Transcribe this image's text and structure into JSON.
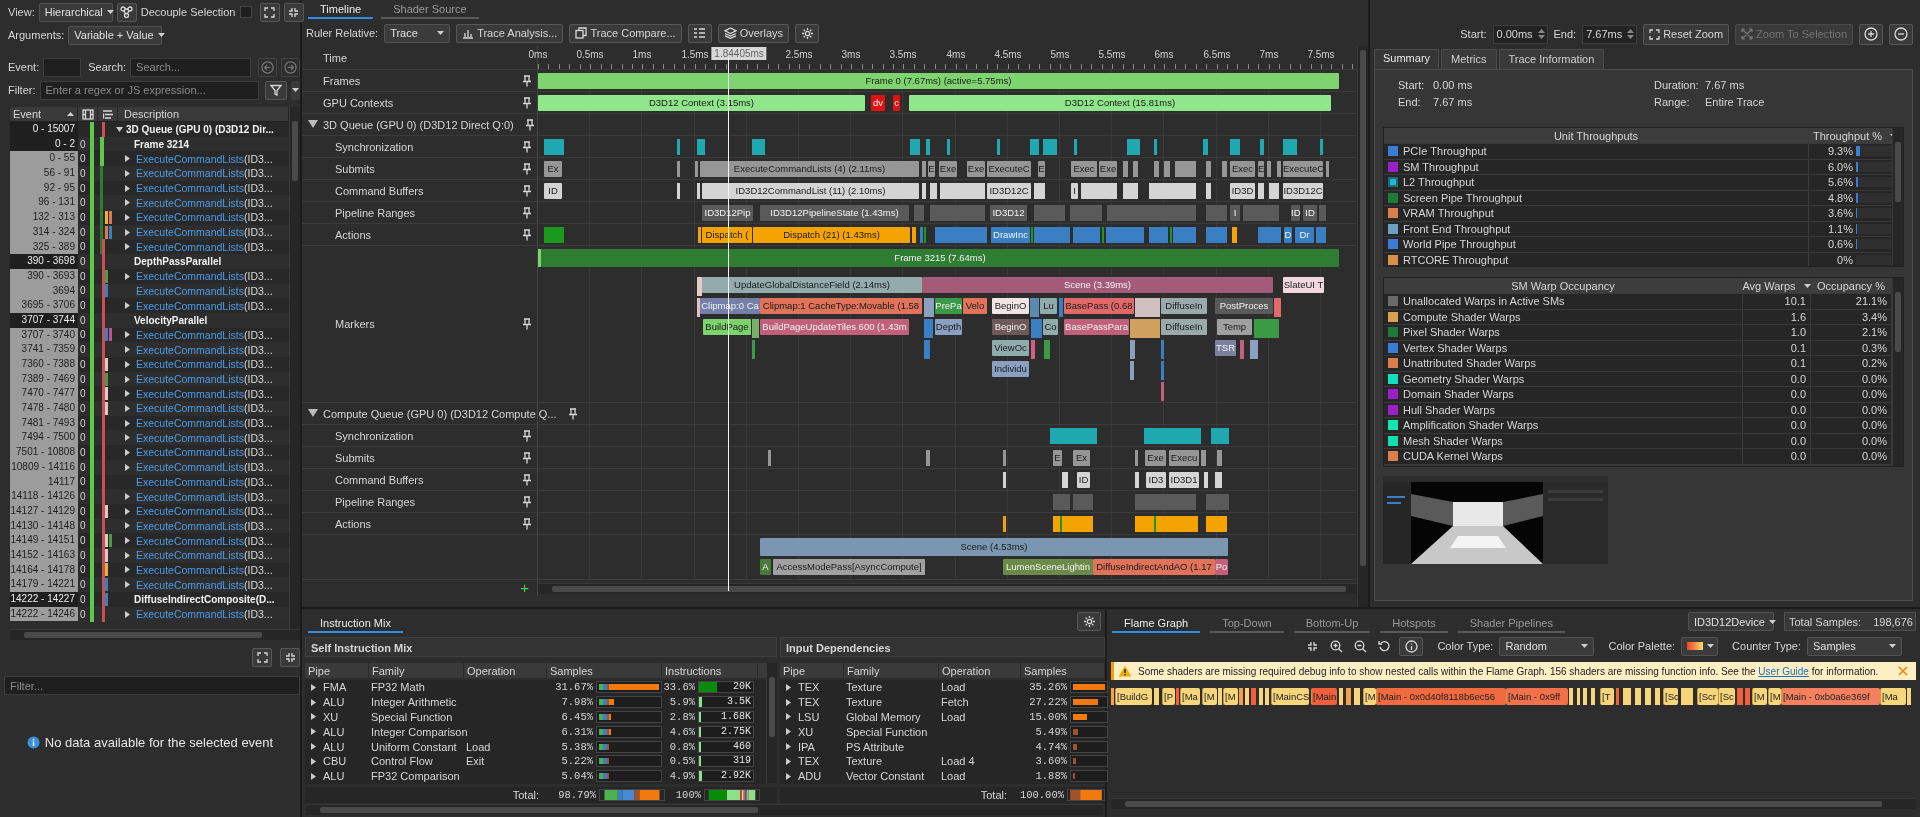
{
  "left_panel": {
    "view_label": "View:",
    "view": "Hierarchical",
    "decouple_label": "Decouple Selection",
    "decouple_checked": false,
    "arguments_label": "Arguments:",
    "arguments": "Variable + Value",
    "event_label": "Event:",
    "search_label": "Search:",
    "search_placeholder": "Search...",
    "filter_label": "Filter:",
    "filter_placeholder": "Enter a regex or JS expression...",
    "columns": [
      "Event",
      "Description"
    ],
    "rows": [
      {
        "event": "0 - 15007",
        "description": "3D Queue (GPU 0) (D3D12 Dir...",
        "kind": "queue",
        "expanded": true,
        "children": [
          {
            "event": "0 - 2",
            "count": "0",
            "description": "Frame 3214",
            "kind": "marker"
          },
          {
            "event": "0 - 55",
            "count": "0",
            "call": "ExecuteCommandLists",
            "args": "(ID3...",
            "kind": "call",
            "expanded": false
          },
          {
            "event": "56 - 91",
            "count": "0",
            "call": "ExecuteCommandLists",
            "args": "(ID3...",
            "kind": "call",
            "expanded": false
          },
          {
            "event": "92 - 95",
            "count": "0",
            "call": "ExecuteCommandLists",
            "args": "(ID3...",
            "kind": "call",
            "expanded": false
          },
          {
            "event": "96 - 131",
            "count": "0",
            "call": "ExecuteCommandLists",
            "args": "(ID3...",
            "kind": "call",
            "expanded": false
          },
          {
            "event": "132 - 313",
            "count": "0",
            "call": "ExecuteCommandLists",
            "args": "(ID3...",
            "kind": "call",
            "expanded": false
          },
          {
            "event": "314 - 324",
            "count": "0",
            "call": "ExecuteCommandLists",
            "args": "(ID3...",
            "kind": "call",
            "expanded": false
          },
          {
            "event": "325 - 389",
            "count": "0",
            "call": "ExecuteCommandLists",
            "args": "(ID3...",
            "kind": "call",
            "expanded": false
          },
          {
            "event": "390 - 3698",
            "count": "0",
            "description": "DepthPassParallel",
            "kind": "marker"
          },
          {
            "event": "390 - 3693",
            "count": "0",
            "call": "ExecuteCommandLists",
            "args": "(ID3...",
            "kind": "call",
            "expanded": false
          },
          {
            "event": "3694",
            "count": "0",
            "call": "ExecuteCommandLists",
            "args": "(ID3...",
            "kind": "call"
          },
          {
            "event": "3695 - 3706",
            "count": "0",
            "call": "ExecuteCommandLists",
            "args": "(ID3...",
            "kind": "call",
            "expanded": false
          },
          {
            "event": "3707 - 3744",
            "count": "0",
            "description": "VelocityParallel",
            "kind": "marker"
          },
          {
            "event": "3707 - 3740",
            "count": "0",
            "call": "ExecuteCommandLists",
            "args": "(ID3...",
            "kind": "call",
            "expanded": false
          },
          {
            "event": "3741 - 7359",
            "count": "0",
            "call": "ExecuteCommandLists",
            "args": "(ID3...",
            "kind": "call",
            "expanded": false
          },
          {
            "event": "7360 - 7388",
            "count": "0",
            "call": "ExecuteCommandLists",
            "args": "(ID3...",
            "kind": "call",
            "expanded": false
          },
          {
            "event": "7389 - 7469",
            "count": "0",
            "call": "ExecuteCommandLists",
            "args": "(ID3...",
            "kind": "call",
            "expanded": false
          },
          {
            "event": "7470 - 7477",
            "count": "0",
            "call": "ExecuteCommandLists",
            "args": "(ID3...",
            "kind": "call",
            "expanded": false
          },
          {
            "event": "7478 - 7480",
            "count": "0",
            "call": "ExecuteCommandLists",
            "args": "(ID3...",
            "kind": "call",
            "expanded": false
          },
          {
            "event": "7481 - 7493",
            "count": "0",
            "call": "ExecuteCommandLists",
            "args": "(ID3...",
            "kind": "call",
            "expanded": false
          },
          {
            "event": "7494 - 7500",
            "count": "0",
            "call": "ExecuteCommandLists",
            "args": "(ID3...",
            "kind": "call",
            "expanded": false
          },
          {
            "event": "7501 - 10808",
            "count": "0",
            "call": "ExecuteCommandLists",
            "args": "(ID3...",
            "kind": "call",
            "expanded": false
          },
          {
            "event": "10809 - 14116",
            "count": "0",
            "call": "ExecuteCommandLists",
            "args": "(ID3...",
            "kind": "call",
            "expanded": false
          },
          {
            "event": "14117",
            "count": "0",
            "call": "ExecuteCommandLists",
            "args": "(ID3...",
            "kind": "call"
          },
          {
            "event": "14118 - 14126",
            "count": "0",
            "call": "ExecuteCommandLists",
            "args": "(ID3...",
            "kind": "call",
            "expanded": false
          },
          {
            "event": "14127 - 14129",
            "count": "0",
            "call": "ExecuteCommandLists",
            "args": "(ID3...",
            "kind": "call",
            "expanded": false
          },
          {
            "event": "14130 - 14148",
            "count": "0",
            "call": "ExecuteCommandLists",
            "args": "(ID3...",
            "kind": "call",
            "expanded": false
          },
          {
            "event": "14149 - 14151",
            "count": "0",
            "call": "ExecuteCommandLists",
            "args": "(ID3...",
            "kind": "call",
            "expanded": false
          },
          {
            "event": "14152 - 14163",
            "count": "0",
            "call": "ExecuteCommandLists",
            "args": "(ID3...",
            "kind": "call",
            "expanded": false
          },
          {
            "event": "14164 - 14178",
            "count": "0",
            "call": "ExecuteCommandLists",
            "args": "(ID3...",
            "kind": "call",
            "expanded": false
          },
          {
            "event": "14179 - 14221",
            "count": "0",
            "call": "ExecuteCommandLists",
            "args": "(ID3...",
            "kind": "call",
            "expanded": false
          },
          {
            "event": "14222 - 14227",
            "count": "0",
            "description": "DiffuseIndirectComposite(D...",
            "kind": "marker"
          },
          {
            "event": "14222 - 14246",
            "count": "0",
            "call": "ExecuteCommandLists",
            "args": "(ID3...",
            "kind": "call",
            "expanded": false
          }
        ]
      }
    ],
    "details_filter_placeholder": "Filter...",
    "message": "No data available for the selected event"
  },
  "view_tabs": [
    {
      "label": "Timeline",
      "selected": true
    },
    {
      "label": "Shader Source",
      "selected": false
    }
  ],
  "timeline_toolbar": {
    "ruler_label": "Ruler Relative:",
    "ruler": "Trace",
    "buttons": [
      "Trace Analysis...",
      "Trace Compare...",
      "Overlays"
    ]
  },
  "timeline": {
    "time_label": "Time",
    "ticks": [
      "0ms",
      "0.5ms",
      "1ms",
      "1.5ms",
      "2.5ms",
      "3ms",
      "3.5ms",
      "4ms",
      "4.5ms",
      "5ms",
      "5.5ms",
      "6ms",
      "6.5ms",
      "7ms",
      "7.5ms"
    ],
    "cursor": "1.84405ms",
    "add_track": "+",
    "tracks": [
      {
        "label": "Frames",
        "kind": "track",
        "bars": [
          {
            "label": "Frame 0 (7.67ms) (active=5.75ms)",
            "color": "#7ed56f"
          }
        ]
      },
      {
        "label": "GPU Contexts",
        "kind": "track",
        "bars": [
          {
            "label": "D3D12 Context (3.15ms)",
            "color": "#90e68a"
          },
          {
            "label": "dv",
            "color": "#e01010"
          },
          {
            "label": "c",
            "color": "#e01010"
          },
          {
            "label": "D3D12 Context (15.81ms)",
            "color": "#90e68a"
          }
        ]
      },
      {
        "label": "3D Queue (GPU 0) (D3D12 Direct Q:0)",
        "kind": "queue",
        "expanded": true
      },
      {
        "label": "Synchronization",
        "kind": "sub"
      },
      {
        "label": "Submits",
        "kind": "sub",
        "bars": [
          {
            "label": "Ex",
            "color": "#969696"
          },
          {
            "label": "ExecuteCommandLists (4) (2.11ms)",
            "color": "#969696"
          },
          {
            "label": "E",
            "color": "#969696"
          },
          {
            "label": "Exe",
            "color": "#969696"
          },
          {
            "label": "Exe",
            "color": "#969696"
          },
          {
            "label": "ExecuteC",
            "color": "#969696"
          },
          {
            "label": "E",
            "color": "#969696"
          },
          {
            "label": "Exec",
            "color": "#969696"
          },
          {
            "label": "Exe",
            "color": "#969696"
          },
          {
            "label": "Exec",
            "color": "#969696"
          },
          {
            "label": "E",
            "color": "#969696"
          },
          {
            "label": "ExecuteC",
            "color": "#969696"
          }
        ]
      },
      {
        "label": "Command Buffers",
        "kind": "sub",
        "bars": [
          {
            "label": "ID",
            "color": "#d4d4d4"
          },
          {
            "label": "ID3D12CommandList (11) (2.10ms)",
            "color": "#d4d4d4"
          },
          {
            "label": "ID3D12C",
            "color": "#d4d4d4"
          },
          {
            "label": "I",
            "color": "#d4d4d4"
          },
          {
            "label": "ID3D",
            "color": "#d4d4d4"
          },
          {
            "label": "ID3D12C",
            "color": "#d4d4d4"
          }
        ]
      },
      {
        "label": "Pipeline Ranges",
        "kind": "sub",
        "bars": [
          {
            "label": "ID3D12Pip",
            "color": "#5a5a5a"
          },
          {
            "label": "ID3D12PipelineState (1.43ms)",
            "color": "#5a5a5a"
          },
          {
            "label": "ID3D12",
            "color": "#5a5a5a"
          },
          {
            "label": "I",
            "color": "#5a5a5a"
          },
          {
            "label": "ID",
            "color": "#5a5a5a"
          },
          {
            "label": "ID",
            "color": "#5a5a5a"
          }
        ]
      },
      {
        "label": "Actions",
        "kind": "sub",
        "bars": [
          {
            "label": "Dispatch (",
            "color": "#f5a300"
          },
          {
            "label": "Dispatch (21) (1.43ms)",
            "color": "#f5a300"
          },
          {
            "label": "DrawInc",
            "color": "#3a7fc4"
          },
          {
            "label": "D",
            "color": "#3a7fc4"
          },
          {
            "label": "Dr",
            "color": "#3a7fc4"
          }
        ]
      },
      {
        "label": "Markers",
        "kind": "markers",
        "levels": [
          {
            "bars": [
              {
                "label": "Frame 3215 (7.64ms)",
                "color": "#2e7d32"
              }
            ]
          },
          {
            "bars": [
              {
                "label": "UpdateGlobalDistanceField (2.14ms)",
                "color": "#93abab"
              },
              {
                "label": "Scene (3.39ms)",
                "color": "#a55a78"
              },
              {
                "label": "SlateUI T",
                "color": "#f2d8de"
              }
            ]
          },
          {
            "bars": [
              {
                "label": "Clipmap:0 Ca",
                "color": "#7480a8"
              },
              {
                "label": "Clipmap:1 CacheType:Movable (1.58",
                "color": "#e0735a"
              },
              {
                "label": "PrePa",
                "color": "#3a9a45"
              },
              {
                "label": "Velo",
                "color": "#e0735a"
              },
              {
                "label": "BeginO",
                "color": "#f0e4e4"
              },
              {
                "label": "Lu",
                "color": "#8fabab"
              },
              {
                "label": "BasePass (0.68",
                "color": "#e06a6a"
              },
              {
                "label": "DiffuseIn",
                "color": "#9aaaaa"
              },
              {
                "label": "PostProces",
                "color": "#5a5a5a"
              }
            ]
          },
          {
            "bars": [
              {
                "label": "BuildPage",
                "color": "#7cd36b"
              },
              {
                "label": "BuildPageUpdateTiles 600 (1.43m",
                "color": "#c0607a"
              },
              {
                "label": "Depth",
                "color": "#8aa0c0"
              },
              {
                "label": "BeginO",
                "color": "#6e5858"
              },
              {
                "label": "Co",
                "color": "#8fabab"
              },
              {
                "label": "BasePassPara",
                "color": "#c0607a"
              },
              {
                "label": "DiffuseIn",
                "color": "#9aaaaa"
              },
              {
                "label": "Temp",
                "color": "#a0a0a0"
              }
            ]
          },
          {
            "bars": [
              {
                "label": "ViewOc",
                "color": "#8fabab"
              },
              {
                "label": "TSR",
                "color": "#7a82a0"
              }
            ]
          },
          {
            "bars": [
              {
                "label": "Individu",
                "color": "#8aa0c0"
              }
            ]
          }
        ]
      },
      {
        "label": "Compute Queue (GPU 0) (D3D12 Compute Q...",
        "kind": "queue",
        "expanded": true
      },
      {
        "label": "Synchronization",
        "kind": "sub"
      },
      {
        "label": "Submits",
        "kind": "sub",
        "bars": [
          {
            "label": "E",
            "color": "#969696"
          },
          {
            "label": "Ex",
            "color": "#969696"
          },
          {
            "label": "Exe",
            "color": "#969696"
          },
          {
            "label": "Execu",
            "color": "#969696"
          }
        ]
      },
      {
        "label": "Command Buffers",
        "kind": "sub",
        "bars": [
          {
            "label": "ID",
            "color": "#d4d4d4"
          },
          {
            "label": "ID3",
            "color": "#d4d4d4"
          },
          {
            "label": "ID3D1",
            "color": "#d4d4d4"
          }
        ]
      },
      {
        "label": "Pipeline Ranges",
        "kind": "sub"
      },
      {
        "label": "Actions",
        "kind": "sub"
      },
      {
        "kind": "markers",
        "levels": [
          {
            "bars": [
              {
                "label": "Scene (4.53ms)",
                "color": "#7b96b0"
              }
            ]
          },
          {
            "bars": [
              {
                "label": "A",
                "color": "#4a7a3a"
              },
              {
                "label": "AccessModePass[AsyncCompute]",
                "color": "#a0a0a0"
              },
              {
                "label": "LumenSceneLightin",
                "color": "#6b8a4a"
              },
              {
                "label": "DiffuseIndirectAndAO (1.17",
                "color": "#e0735a"
              },
              {
                "label": "Po",
                "color": "#c0607a"
              }
            ]
          }
        ]
      }
    ]
  },
  "range": {
    "start_label": "Start:",
    "start": "0.00ms",
    "end_label": "End:",
    "end": "7.67ms",
    "buttons": [
      {
        "label": "Reset Zoom",
        "disabled": false
      },
      {
        "label": "Zoom To Selection",
        "disabled": true
      }
    ]
  },
  "summary_tabs": [
    {
      "label": "Summary",
      "selected": true
    },
    {
      "label": "Metrics",
      "selected": false
    },
    {
      "label": "Trace Information",
      "selected": false
    }
  ],
  "summary": {
    "fields": [
      {
        "label": "Start:",
        "value": "0.00 ms"
      },
      {
        "label": "Duration:",
        "value": "7.67 ms"
      },
      {
        "label": "End:",
        "value": "7.67 ms"
      },
      {
        "label": "Range:",
        "value": "Entire Trace"
      }
    ]
  },
  "throughputs": {
    "columns": [
      "Unit Throughputs",
      "Throughput %"
    ],
    "rows": [
      {
        "name": "PCIe Throughput",
        "color": "#3a7bd5",
        "value": "9.3%",
        "level": 0.093
      },
      {
        "name": "SM Throughput",
        "color": "#9b1fc9",
        "value": "6.0%",
        "level": 0.06
      },
      {
        "name": "L2 Throughput",
        "color": "#2ab0c8",
        "value": "5.6%",
        "level": 0.056
      },
      {
        "name": "Screen Pipe Throughput",
        "color": "#1f7a3a",
        "value": "4.8%",
        "level": 0.048
      },
      {
        "name": "VRAM Throughput",
        "color": "#d9804a",
        "value": "3.6%",
        "level": 0.036
      },
      {
        "name": "Front End Throughput",
        "color": "#6f9fc0",
        "value": "1.1%",
        "level": 0.011
      },
      {
        "name": "World Pipe Throughput",
        "color": "#3a7bd6",
        "value": "0.6%",
        "level": 0.006
      },
      {
        "name": "RTCORE Throughput",
        "color": "#d9904a",
        "value": "0%",
        "level": 0
      }
    ]
  },
  "warps": {
    "columns": [
      "SM Warp Occupancy",
      "Avg Warps",
      "Occupancy %"
    ],
    "rows": [
      {
        "name": "Unallocated Warps in Active SMs",
        "color": "#6a6a6a",
        "avg": "10.1",
        "occupancy": "21.1%"
      },
      {
        "name": "Compute Shader Warps",
        "color": "#d9a050",
        "avg": "1.6",
        "occupancy": "3.4%"
      },
      {
        "name": "Pixel Shader Warps",
        "color": "#1f7a3a",
        "avg": "1.0",
        "occupancy": "2.1%"
      },
      {
        "name": "Vertex Shader Warps",
        "color": "#3a7bd5",
        "avg": "0.1",
        "occupancy": "0.3%"
      },
      {
        "name": "Unattributed Shader Warps",
        "color": "#d9804a",
        "avg": "0.1",
        "occupancy": "0.2%"
      },
      {
        "name": "Geometry Shader Warps",
        "color": "#10e0c0",
        "avg": "0.0",
        "occupancy": "0.0%"
      },
      {
        "name": "Domain Shader Warps",
        "color": "#9b1fc9",
        "avg": "0.0",
        "occupancy": "0.0%"
      },
      {
        "name": "Hull Shader Warps",
        "color": "#9b1fca",
        "avg": "0.0",
        "occupancy": "0.0%"
      },
      {
        "name": "Amplification Shader Warps",
        "color": "#10e8b0",
        "avg": "0.0",
        "occupancy": "0.0%"
      },
      {
        "name": "Mesh Shader Warps",
        "color": "#10e0b0",
        "avg": "0.0",
        "occupancy": "0.0%"
      },
      {
        "name": "CUDA Kernel Warps",
        "color": "#d9804b",
        "avg": "0.0",
        "occupancy": "0.0%"
      }
    ]
  },
  "instruction_mix": {
    "tabs": [
      {
        "label": "Instruction Mix",
        "selected": true
      }
    ],
    "self": {
      "title": "Self Instruction Mix",
      "columns": [
        "Pipe",
        "Family",
        "Operation",
        "Samples",
        "Instructions"
      ],
      "rows": [
        {
          "expanded": false,
          "pipe": "FMA",
          "family": "FP32 Math",
          "samples": {
            "text": "31.67%",
            "level": 1
          },
          "instructions": {
            "text": "33.6%",
            "level": 0.336,
            "count": "20K"
          }
        },
        {
          "expanded": false,
          "pipe": "ALU",
          "family": "Integer Arithmetic",
          "samples": {
            "text": "7.98%",
            "level": 0.25
          },
          "instructions": {
            "text": "5.9%",
            "level": 0.059,
            "count": "3.5K"
          }
        },
        {
          "expanded": false,
          "pipe": "XU",
          "family": "Special Function",
          "samples": {
            "text": "6.45%",
            "level": 0.2
          },
          "instructions": {
            "text": "2.8%",
            "level": 0.028,
            "count": "1.68K"
          }
        },
        {
          "expanded": false,
          "pipe": "ALU",
          "family": "Integer Comparison",
          "samples": {
            "text": "6.31%",
            "level": 0.2
          },
          "instructions": {
            "text": "4.6%",
            "level": 0.046,
            "count": "2.75K"
          }
        },
        {
          "expanded": false,
          "pipe": "ALU",
          "family": "Uniform Constant",
          "operation": "Load",
          "samples": {
            "text": "5.38%",
            "level": 0.17
          },
          "instructions": {
            "text": "0.8%",
            "level": 0.008,
            "count": "460"
          }
        },
        {
          "expanded": false,
          "pipe": "CBU",
          "family": "Control Flow",
          "operation": "Exit",
          "samples": {
            "text": "5.22%",
            "level": 0.165
          },
          "instructions": {
            "text": "0.5%",
            "level": 0.005,
            "count": "319"
          }
        },
        {
          "expanded": false,
          "pipe": "ALU",
          "family": "FP32 Comparison",
          "samples": {
            "text": "5.04%",
            "level": 0.16
          },
          "instructions": {
            "text": "4.9%",
            "level": 0.049,
            "count": "2.92K"
          }
        }
      ],
      "total": {
        "label": "Total:",
        "samples": "98.79%",
        "instructions": "100%"
      }
    },
    "dependencies": {
      "title": "Input Dependencies",
      "columns": [
        "Pipe",
        "Family",
        "Operation",
        "Samples"
      ],
      "rows": [
        {
          "expanded": false,
          "pipe": "TEX",
          "family": "Texture",
          "operation": "Load",
          "samples": {
            "text": "35.26%",
            "level": 1
          }
        },
        {
          "expanded": false,
          "pipe": "TEX",
          "family": "Texture",
          "operation": "Fetch",
          "samples": {
            "text": "27.22%",
            "level": 0.77
          }
        },
        {
          "expanded": false,
          "pipe": "LSU",
          "family": "Global Memory",
          "operation": "Load",
          "samples": {
            "text": "15.00%",
            "level": 0.43
          }
        },
        {
          "expanded": false,
          "pipe": "XU",
          "family": "Special Function",
          "samples": {
            "text": "5.49%",
            "level": 0.16
          }
        },
        {
          "expanded": false,
          "pipe": "IPA",
          "family": "PS Attribute",
          "samples": {
            "text": "4.74%",
            "level": 0.13
          }
        },
        {
          "expanded": false,
          "pipe": "TEX",
          "family": "Texture",
          "operation": "Load 4",
          "samples": {
            "text": "3.60%",
            "level": 0.1
          }
        },
        {
          "expanded": false,
          "pipe": "ADU",
          "family": "Vector Constant",
          "operation": "Load",
          "samples": {
            "text": "1.88%",
            "level": 0.05
          }
        }
      ],
      "total": {
        "label": "Total:",
        "samples": "100.00%"
      }
    }
  },
  "flame_graph": {
    "tabs": [
      {
        "label": "Flame Graph",
        "selected": true
      },
      {
        "label": "Top-Down",
        "selected": false
      },
      {
        "label": "Bottom-Up",
        "selected": false
      },
      {
        "label": "Hotspots",
        "selected": false
      },
      {
        "label": "Shader Pipelines",
        "selected": false
      }
    ],
    "device": "ID3D12Device",
    "total_label": "Total Samples:",
    "total": "198,676",
    "color_type_label": "Color Type:",
    "color_type": "Random",
    "palette_label": "Color Palette:",
    "counter_label": "Counter Type:",
    "counter": "Samples",
    "warning": {
      "before": "Some shaders are missing required debug info to show nested calls within the Flame Graph. 156 shaders are missing function info. See the ",
      "link": "User Guide",
      "after": " for information."
    },
    "blocks": [
      {
        "label": "[BuildG",
        "color": "#f7d57a"
      },
      {
        "label": "[P",
        "color": "#f7d57a"
      },
      {
        "label": "[Ma",
        "color": "#f7d57a"
      },
      {
        "label": "[M",
        "color": "#f7d57a"
      },
      {
        "label": "[M",
        "color": "#f7d57a"
      },
      {
        "label": "[MainCS",
        "color": "#f7d57a"
      },
      {
        "label": "[Main",
        "color": "#f0603a"
      },
      {
        "label": "[M",
        "color": "#f7d57a"
      },
      {
        "label": "[Main - 0x0d40f8118b6ec56",
        "color": "#f26a40"
      },
      {
        "label": "[Main - 0x9ff",
        "color": "#f2704a"
      },
      {
        "label": "[T",
        "color": "#f7d57a"
      },
      {
        "label": "[Sc",
        "color": "#f7d57a"
      },
      {
        "label": "[Scr",
        "color": "#f7d57a"
      },
      {
        "label": "[Sc",
        "color": "#f7d57a"
      },
      {
        "label": "[M",
        "color": "#f7d57a"
      },
      {
        "label": "[M",
        "color": "#f7d57a"
      },
      {
        "label": "[Main - 0xb0a6e369f",
        "color": "#f48060"
      },
      {
        "label": "[Ma",
        "color": "#f7d57a"
      }
    ]
  }
}
